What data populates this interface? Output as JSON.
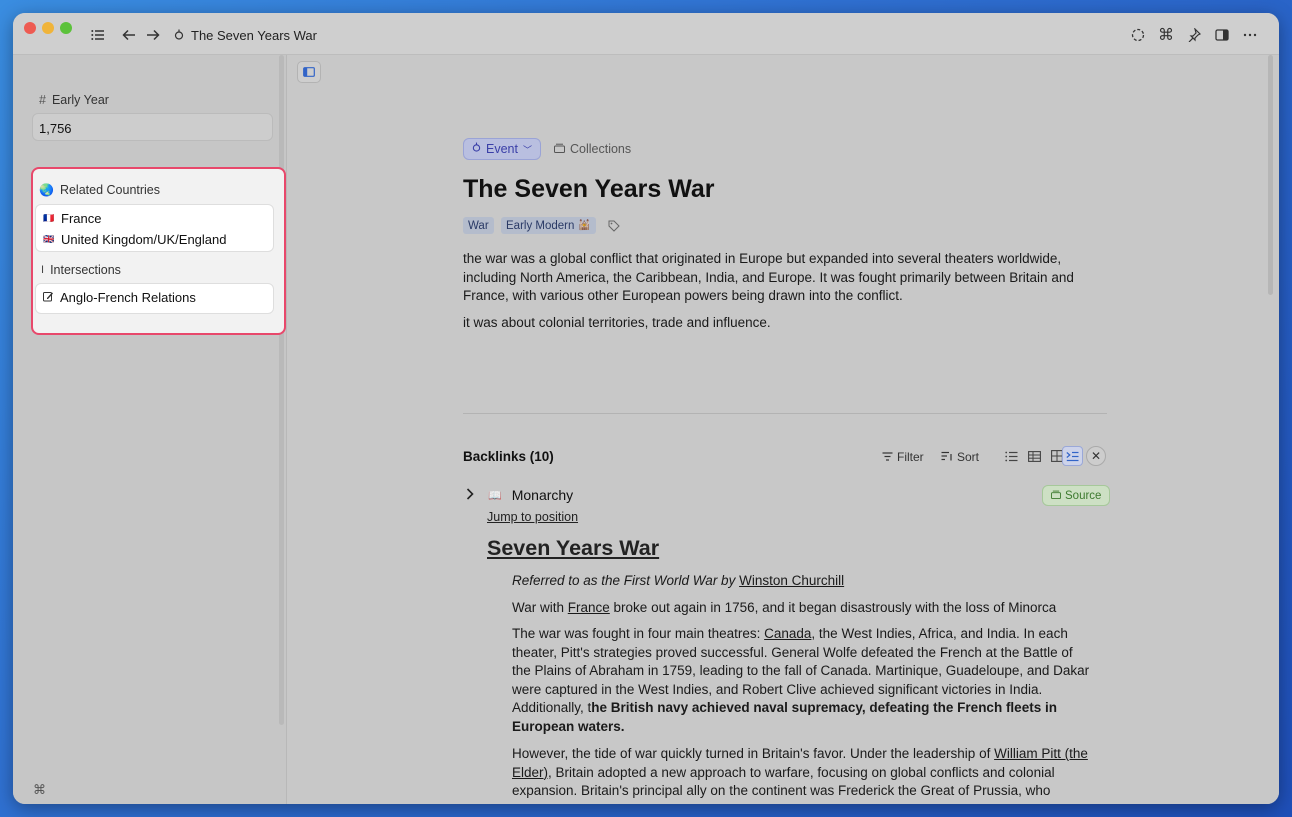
{
  "titlebar": {
    "title": "The Seven Years War",
    "icons": [
      "sidebar-list-icon",
      "back-arrow-icon",
      "forward-arrow-icon",
      "event-icon",
      "loader-icon",
      "command-icon",
      "pin-icon",
      "panel-right-icon",
      "more-icon"
    ]
  },
  "sidebar": {
    "early_year": {
      "label": "Early Year",
      "value": "1,756"
    },
    "related_countries": {
      "label": "Related Countries",
      "items": [
        {
          "flag": "🇫🇷",
          "name": "France"
        },
        {
          "flag": "🇬🇧",
          "name": "United Kingdom/UK/England"
        }
      ]
    },
    "intersections": {
      "label": "Intersections",
      "items": [
        {
          "name": "Anglo-French Relations"
        }
      ]
    },
    "footer_symbol": "⌘"
  },
  "page": {
    "type_label": "Event",
    "collections_label": "Collections",
    "title": "The Seven Years War",
    "tags": [
      {
        "label": "War"
      },
      {
        "label": "Early Modern"
      }
    ],
    "paragraph1": "the war was a global conflict that originated in Europe but expanded into several theaters worldwide, including North America, the Caribbean, India, and Europe. It was fought primarily between Britain and France, with various other European powers being drawn into the conflict.",
    "paragraph2": "it was about colonial territories, trade and influence."
  },
  "backlinks": {
    "title": "Backlinks (10)",
    "filter_label": "Filter",
    "sort_label": "Sort",
    "item": {
      "title": "Monarchy",
      "source_label": "Source",
      "jump_label": "Jump to position",
      "heading": "Seven Years War",
      "quote_prefix": "Referred to as the First World War by ",
      "quote_link": "Winston Churchill",
      "line2_prefix": "War with ",
      "line2_link": "France",
      "line2_suffix": " broke out again in 1756, and it began disastrously with the loss of Minorca",
      "p3_prefix": "The war was fought in four main theatres: ",
      "p3_link": "Canada",
      "p3_mid": ", the West Indies, Africa, and India. In each theater, Pitt's strategies proved successful. General Wolfe defeated the French at the Battle of the Plains of Abraham in 1759, leading to the fall of Canada. Martinique, Guadeloupe, and Dakar were captured in the West Indies, and Robert Clive achieved significant victories in India. Additionally, t",
      "p3_bold": "he British navy achieved naval supremacy, defeating the French fleets in European waters.",
      "p4_prefix": "However, the tide of war quickly turned in Britain's favor. Under the leadership of ",
      "p4_link": "William Pitt (the Elder)",
      "p4_suffix": ", Britain adopted a new approach to warfare, focusing on global conflicts and colonial expansion. Britain's principal ally on the continent was Frederick the Great of Prussia, who received financial support but no troops. Meanwhile, British forces were"
    }
  },
  "colors": {
    "highlight_border": "#e8486b",
    "event_pill": "#b9bfe0",
    "source_pill": "#cde0c4"
  }
}
